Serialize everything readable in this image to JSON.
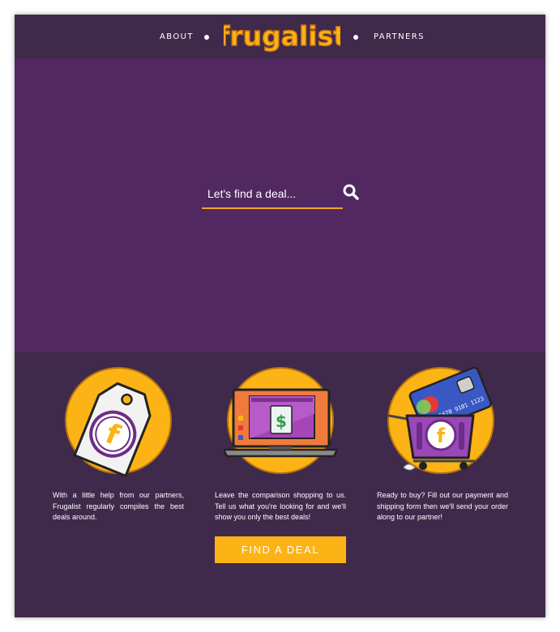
{
  "nav": {
    "about_label": "ABOUT",
    "partners_label": "PARTNERS",
    "logo_text": "frugalist"
  },
  "hero": {
    "search_placeholder": "Let's find a deal...",
    "search_icon": "search-icon"
  },
  "features": [
    {
      "icon": "price-tag-icon",
      "text": "With a little help from our partners, Frugalist regularly compiles the best deals around."
    },
    {
      "icon": "laptop-icon",
      "text": "Leave the comparison shopping to us. Tell us what you're looking for and we'll show you only the best deals!"
    },
    {
      "icon": "shopping-cart-icon",
      "text": "Ready to buy? Fill out our payment and shipping form then we'll send your order along to our partner!"
    }
  ],
  "cta": {
    "label": "FIND A DEAL"
  },
  "colors": {
    "header_bg": "#3f2a4c",
    "hero_bg": "#522861",
    "accent": "#fcb316"
  }
}
